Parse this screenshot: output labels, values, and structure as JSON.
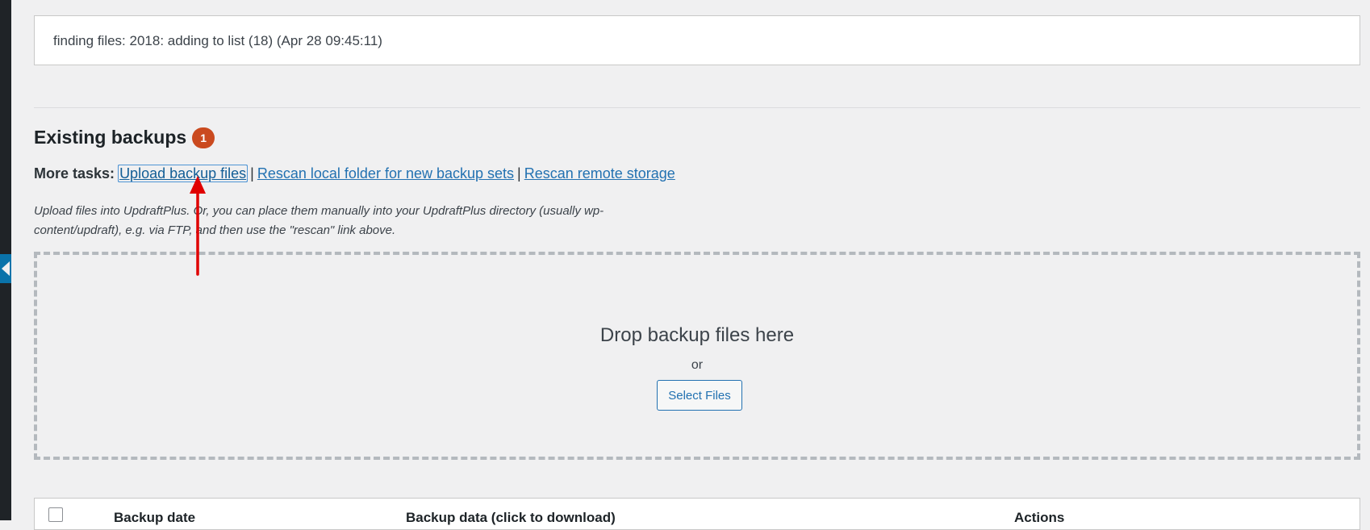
{
  "log": {
    "message": "finding files: 2018: adding to list (18) (Apr 28 09:45:11)"
  },
  "existing_backups": {
    "heading": "Existing backups",
    "count": "1",
    "more_tasks_label": "More tasks:",
    "links": [
      "Upload backup files",
      "Rescan local folder for new backup sets",
      "Rescan remote storage"
    ],
    "separator": "|",
    "help_text": "Upload files into UpdraftPlus. Or, you can place them manually into your UpdraftPlus directory (usually wp-content/updraft), e.g. via FTP, and then use the \"rescan\" link above."
  },
  "dropzone": {
    "title": "Drop backup files here",
    "or": "or",
    "button": "Select Files"
  },
  "table": {
    "headers": [
      "Backup date",
      "Backup data (click to download)",
      "Actions"
    ]
  },
  "colors": {
    "link": "#2271b1",
    "badge": "#ca4a1f",
    "annotation": "#e00000"
  }
}
